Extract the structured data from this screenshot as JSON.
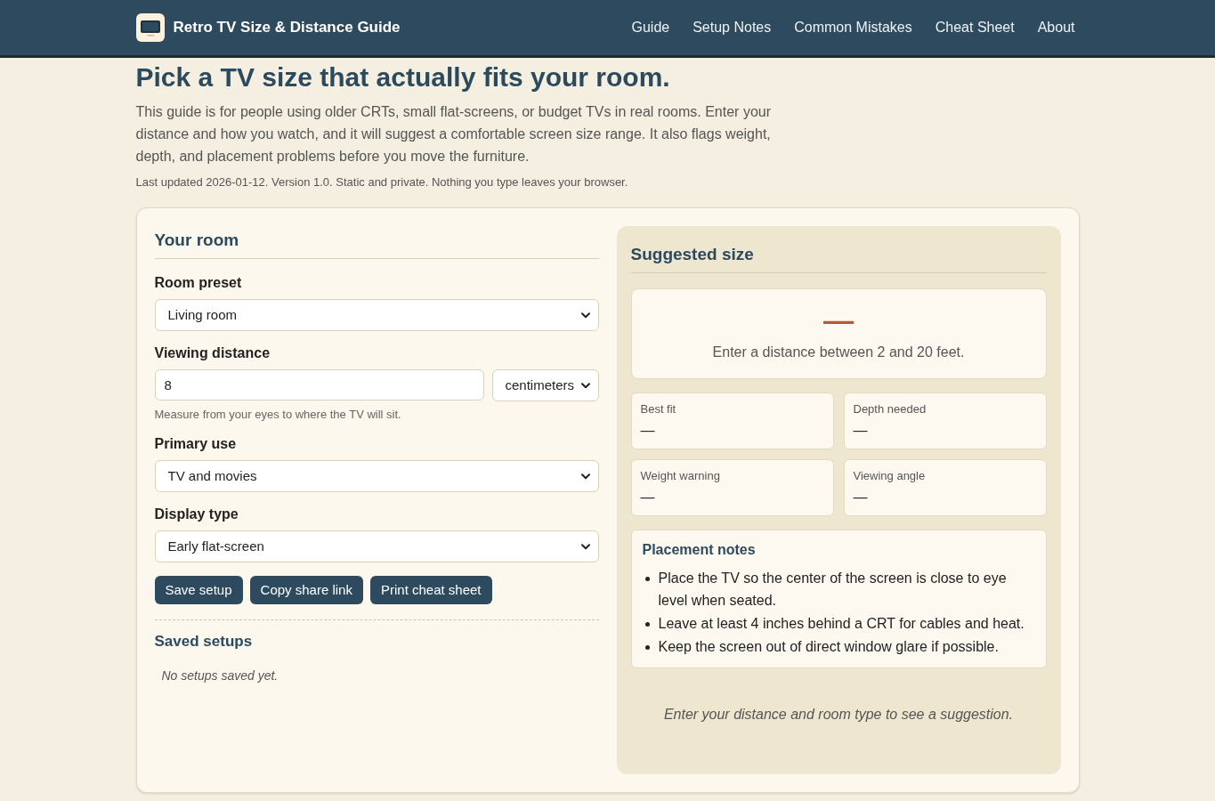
{
  "header": {
    "title": "Retro TV Size & Distance Guide",
    "nav": [
      {
        "label": "Guide"
      },
      {
        "label": "Setup Notes"
      },
      {
        "label": "Common Mistakes"
      },
      {
        "label": "Cheat Sheet"
      },
      {
        "label": "About"
      }
    ]
  },
  "intro": {
    "heading": "Pick a TV size that actually fits your room.",
    "description": "This guide is for people using older CRTs, small flat-screens, or budget TVs in real rooms. Enter your distance and how you watch, and it will suggest a comfortable screen size range. It also flags weight, depth, and placement problems before you move the furniture.",
    "meta": "Last updated 2026-01-12. Version 1.0. Static and private. Nothing you type leaves your browser."
  },
  "room_form": {
    "title": "Your room",
    "fields": [
      {
        "kind": "select",
        "label": "Room preset",
        "value": "Living room"
      },
      {
        "kind": "number_with_unit",
        "label": "Viewing distance",
        "value": "8",
        "unit": "centimeters",
        "hint": "Measure from your eyes to where the TV will sit."
      },
      {
        "kind": "select",
        "label": "Primary use",
        "value": "TV and movies"
      },
      {
        "kind": "select",
        "label": "Display type",
        "value": "Early flat-screen"
      }
    ],
    "buttons": [
      "Save setup",
      "Copy share link",
      "Print cheat sheet"
    ],
    "saved": {
      "title": "Saved setups",
      "empty": "No setups saved yet."
    }
  },
  "suggestion": {
    "title": "Suggested size",
    "result": {
      "value": "—",
      "message": "Enter a distance between 2 and 20 feet."
    },
    "stats": [
      {
        "label": "Best fit",
        "value": "—"
      },
      {
        "label": "Depth needed",
        "value": "—"
      },
      {
        "label": "Weight warning",
        "value": "—"
      },
      {
        "label": "Viewing angle",
        "value": "—"
      }
    ],
    "placement": {
      "title": "Placement notes",
      "items": [
        "Place the TV so the center of the screen is close to eye level when seated.",
        "Leave at least 4 inches behind a CRT for cables and heat.",
        "Keep the screen out of direct window glare if possible."
      ]
    },
    "footer": "Enter your distance and room type to see a suggestion."
  }
}
